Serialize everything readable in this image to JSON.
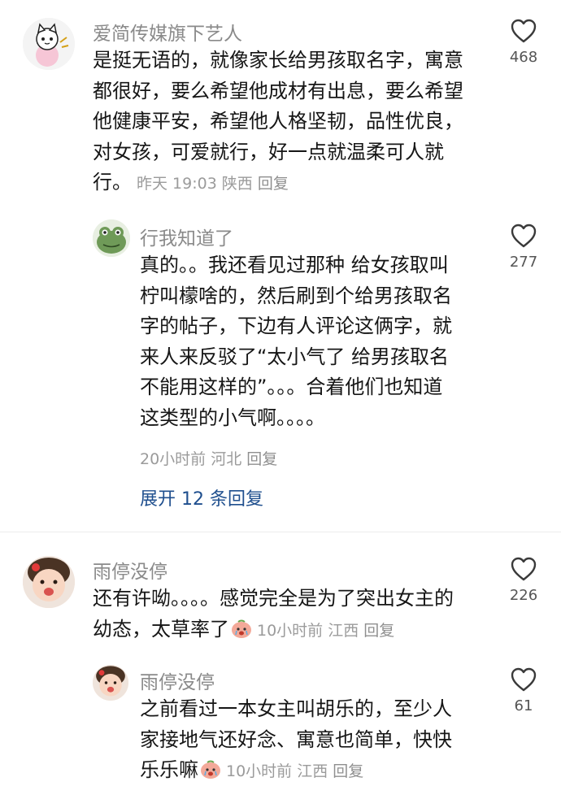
{
  "comments": [
    {
      "author": "爱简传媒旗下艺人",
      "lines": [
        "是挺无语的，就像家长给男孩取名字，寓意",
        "都很好，要么希望他成材有出息，要么希望",
        "他健康平安，希望他人格坚韧，品性优良，",
        "对女孩，可爱就行，好一点就温柔可人就",
        "行。"
      ],
      "time": "昨天 19:03",
      "location": "陕西",
      "reply": "回复",
      "likes": "468"
    },
    {
      "author": "行我知道了",
      "lines": [
        "真的。。我还看见过那种 给女孩取叫",
        "柠叫檬啥的，然后刷到个给男孩取名",
        "字的帖子，下边有人评论这俩字，就",
        "来人来反驳了“太小气了 给男孩取名",
        "不能用这样的”。。。合着他们也知道",
        "这类型的小气啊。。。。"
      ],
      "time": "20小时前",
      "location": "河北",
      "reply": "回复",
      "likes": "277",
      "expand": "展开 12 条回复"
    },
    {
      "author": "雨停没停",
      "lines": [
        "还有许呦。。。。感觉完全是为了突出女主的",
        "幼态，太草率了"
      ],
      "time": "10小时前",
      "location": "江西",
      "reply": "回复",
      "likes": "226"
    },
    {
      "author": "雨停没停",
      "lines": [
        "之前看过一本女主叫胡乐的，至少人",
        "家接地气还好念、寓意也简单，快快",
        "乐乐嘛"
      ],
      "time": "10小时前",
      "location": "江西",
      "reply": "回复",
      "likes": "61"
    }
  ],
  "icons": {
    "like": "heart-outline-icon",
    "emoji": "crying-face-emoji-icon"
  },
  "colors": {
    "text": "#161616",
    "muted": "#8a8a8a",
    "link": "#1f4f8e"
  }
}
